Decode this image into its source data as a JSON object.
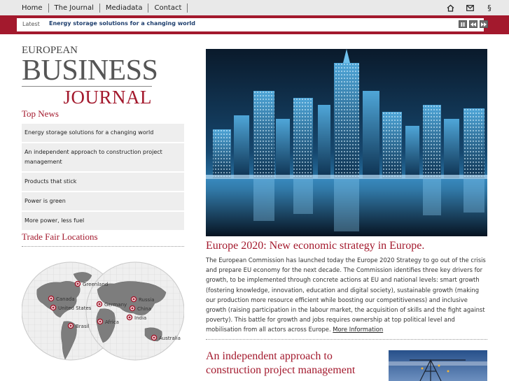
{
  "nav": {
    "links": [
      "Home",
      "The Journal",
      "Mediadata",
      "Contact"
    ],
    "icons": [
      "home-icon",
      "mail-icon",
      "section-icon"
    ]
  },
  "ticker": {
    "label": "Latest",
    "headline": "Energy storage solutions for a changing world",
    "controls": [
      "pause-icon",
      "previous-icon",
      "next-icon"
    ]
  },
  "logo": {
    "line1": "EUROPEAN",
    "line2": "BUSINESS",
    "line3": "JOURNAL"
  },
  "top_news": {
    "title": "Top News",
    "items": [
      "Energy storage solutions for a changing world",
      "An independent approach to construction project management",
      "Products that stick",
      "Power is green",
      "More power, less fuel"
    ]
  },
  "trade_fair": {
    "title": "Trade Fair Locations",
    "locations": [
      "Greenland",
      "Canada",
      "United States",
      "Germany",
      "Russia",
      "China",
      "India",
      "Africa",
      "Brasil",
      "Australia"
    ]
  },
  "article1": {
    "title": "Europe 2020: New economic strategy in Europe.",
    "body": "The European Commission has launched today the Europe 2020 Strategy to go out of the crisis and prepare EU economy for the next decade. The Commission identifies three key drivers for growth, to be implemented through concrete actions at EU and national levels: smart growth (fostering knowledge, innovation, education and digital society), sustainable growth (making our production more resource efficient while boosting our competitiveness) and inclusive growth (raising participation in the labour market, the acquisition of skills and the fight against poverty). This battle for growth and jobs requires ownership at top political level and mobilisation from all actors across Europe.",
    "more": "More Information"
  },
  "article2": {
    "title": "An independent approach to construction project management"
  },
  "colors": {
    "brand_red": "#a3192d",
    "nav_bg": "#e9e9e9",
    "ticker_text": "#1f3f6e"
  }
}
